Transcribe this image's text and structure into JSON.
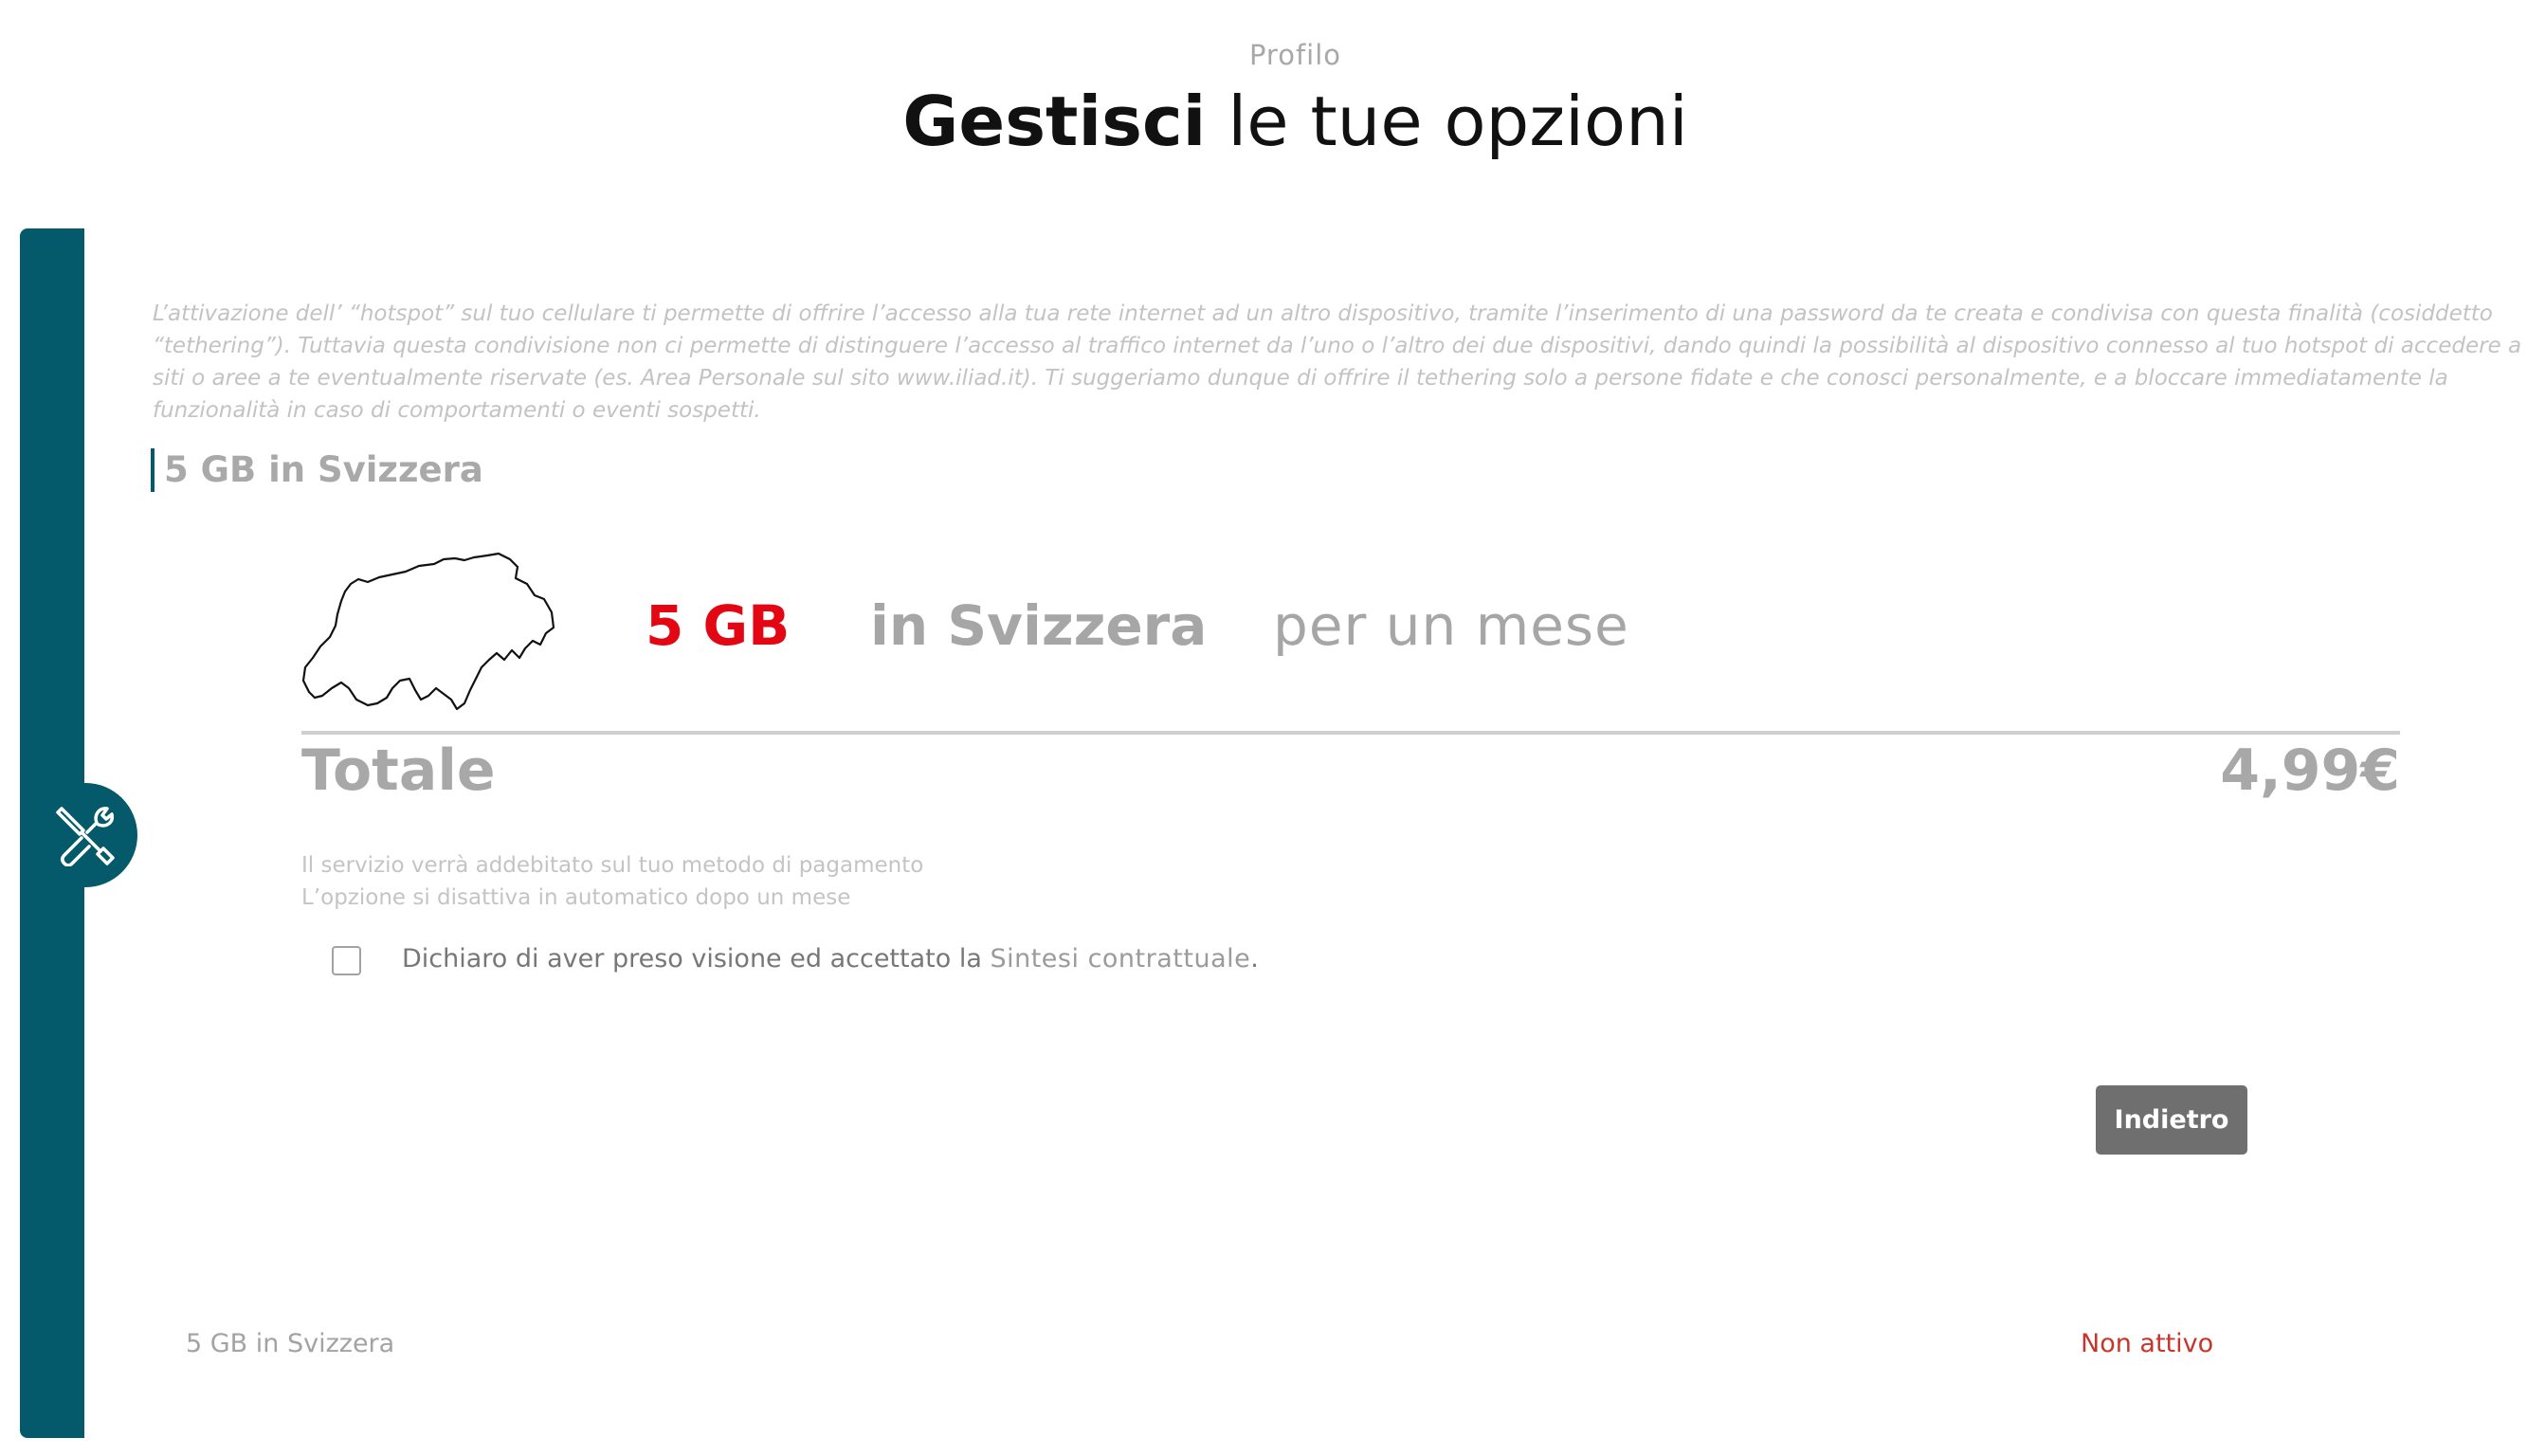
{
  "header": {
    "breadcrumb": "Profilo",
    "title_bold": "Gestisci",
    "title_rest": " le tue opzioni"
  },
  "sidebar": {
    "icon": "tools-icon",
    "accent_color": "#045a6a"
  },
  "disclaimer": "L’attivazione dell’ “hotspot” sul tuo cellulare ti permette di offrire l’accesso alla tua rete internet ad un altro dispositivo, tramite l’inserimento di una password da te creata e condivisa con questa finalità (cosiddetto “tethering”). Tuttavia questa condivisione non ci permette di distinguere l’accesso al traffico internet da l’uno o l’altro dei due dispositivi, dando quindi la possibilità al dispositivo connesso al tuo hotspot di accedere a siti o aree a te eventualmente riservate (es. Area Personale sul sito www.iliad.it). Ti suggeriamo dunque di offrire il tethering solo a persone fidate e che conosci personalmente, e a bloccare immediatamente la funzionalità in caso di comportamenti o eventi sospetti.",
  "section": {
    "heading": "5 GB in Svizzera"
  },
  "offer": {
    "map_icon": "switzerland-map-icon",
    "amount": "5 GB",
    "country": "in Svizzera",
    "period": "per un mese",
    "amount_color": "#e30613"
  },
  "summary": {
    "total_label": "Totale",
    "total_price": "4,99€",
    "info_line_1": "Il servizio verrà addebitato sul tuo metodo di pagamento",
    "info_line_2": "L’opzione si disattiva in automatico dopo un mese"
  },
  "consent": {
    "checked": false,
    "text": "Dichiaro di aver preso visione ed accettato la ",
    "link_text": "Sintesi contrattuale",
    "suffix": "."
  },
  "actions": {
    "back_label": "Indietro"
  },
  "footer": {
    "option_name": "5 GB in Svizzera",
    "status": "Non attivo",
    "status_color": "#c8352b"
  }
}
